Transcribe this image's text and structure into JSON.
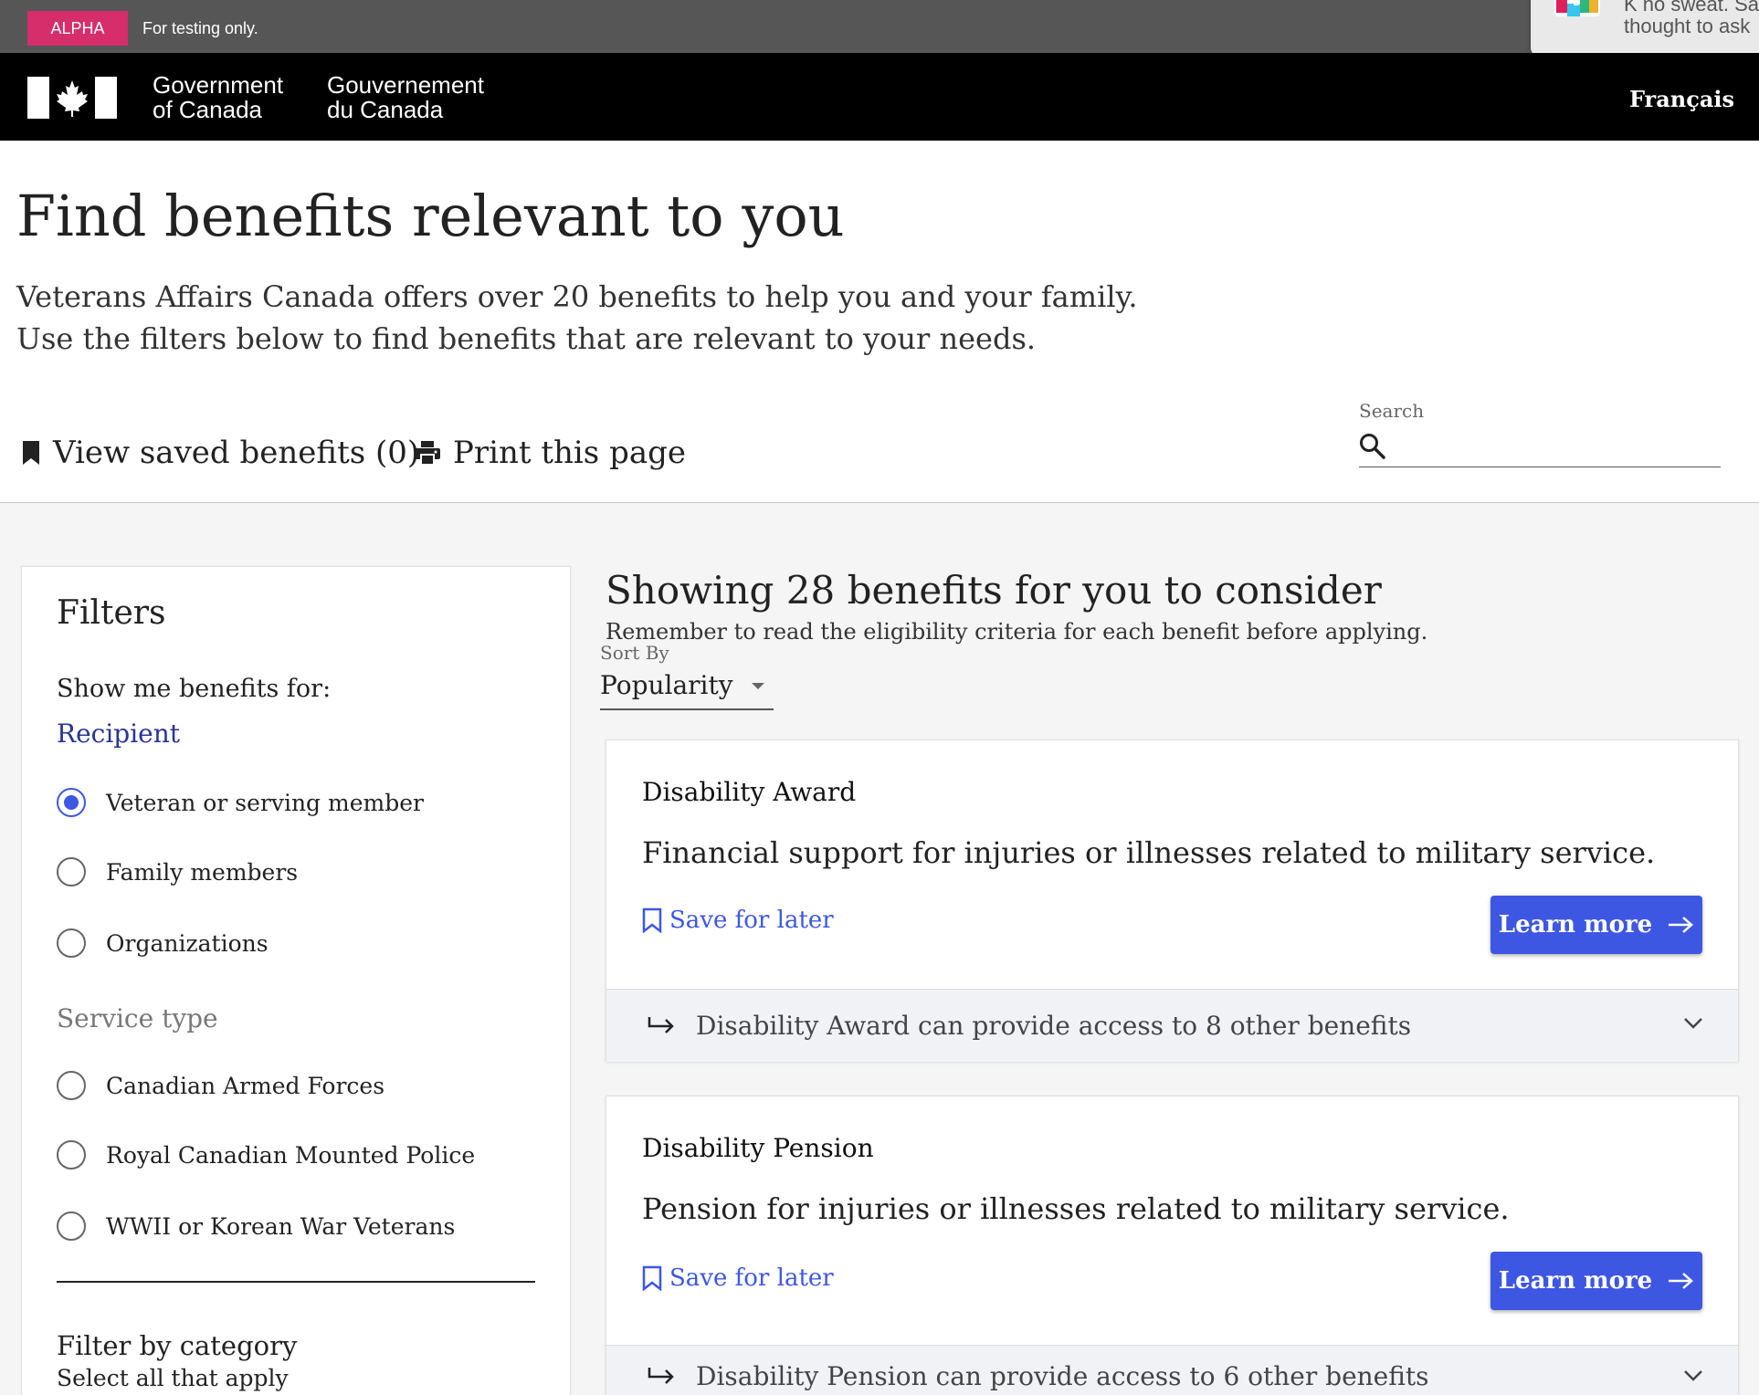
{
  "alpha_banner": {
    "badge": "ALPHA",
    "text": "For testing only."
  },
  "notification": {
    "line1": "K no sweat. Sa",
    "line2": "thought to ask"
  },
  "gov_header": {
    "name_en_line1": "Government",
    "name_en_line2": "of Canada",
    "name_fr_line1": "Gouvernement",
    "name_fr_line2": "du Canada",
    "language_toggle": "Français"
  },
  "page": {
    "title": "Find benefits relevant to you",
    "intro_line1": "Veterans Affairs Canada offers over 20 benefits to help you and your family.",
    "intro_line2": "Use the filters below to find benefits that are relevant to your needs.",
    "view_saved": "View saved benefits (0)",
    "print": "Print this page"
  },
  "search": {
    "label": "Search",
    "value": "",
    "placeholder": ""
  },
  "filters": {
    "title": "Filters",
    "subtitle": "Show me benefits for:",
    "recipient_label": "Recipient",
    "recipient_options": [
      {
        "label": "Veteran or serving member",
        "checked": true
      },
      {
        "label": "Family members",
        "checked": false
      },
      {
        "label": "Organizations",
        "checked": false
      }
    ],
    "service_label": "Service type",
    "service_options": [
      {
        "label": "Canadian Armed Forces",
        "checked": false
      },
      {
        "label": "Royal Canadian Mounted Police",
        "checked": false
      },
      {
        "label": "WWII or Korean War Veterans",
        "checked": false
      }
    ],
    "category_title": "Filter by category",
    "category_sub": "Select all that apply"
  },
  "results": {
    "heading": "Showing 28 benefits for you to consider",
    "subheading": "Remember to read the eligibility criteria for each benefit before applying.",
    "sort_label": "Sort By",
    "sort_value": "Popularity",
    "cards": [
      {
        "title": "Disability Award",
        "description": "Financial support for injuries or illnesses related to military service.",
        "save_label": "Save for later",
        "learn_label": "Learn more",
        "footer": "Disability Award can provide access to 8 other benefits"
      },
      {
        "title": "Disability Pension",
        "description": "Pension for injuries or illnesses related to military service.",
        "save_label": "Save for later",
        "learn_label": "Learn more",
        "footer": "Disability Pension can provide access to 6 other benefits"
      }
    ]
  },
  "colors": {
    "accent": "#3e57e2",
    "alpha_badge": "#d62d6b",
    "alpha_bar": "#565656",
    "header": "#000000"
  },
  "icons": [
    "bookmark-icon",
    "printer-icon",
    "search-icon",
    "bookmark-outline-icon",
    "arrow-right-icon",
    "return-arrow-icon",
    "chevron-down-icon",
    "canada-flag-icon",
    "slack-icon"
  ]
}
